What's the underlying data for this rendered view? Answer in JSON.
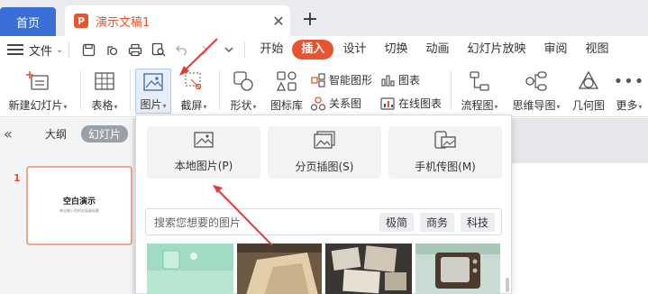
{
  "tabs": {
    "home": "首页",
    "doc_logo": "P",
    "doc_title": "演示文稿1",
    "close": "✕",
    "new": "+"
  },
  "menu": {
    "file": "文件",
    "tabs": [
      "开始",
      "插入",
      "设计",
      "切换",
      "动画",
      "幻灯片放映",
      "审阅",
      "视图"
    ],
    "active_tab": "插入"
  },
  "toolbar": {
    "new_slide": "新建幻灯片",
    "table": "表格",
    "picture": "图片",
    "screenshot": "截屏",
    "shape": "形状",
    "icon_lib": "图标库",
    "smart_art": "智能图形",
    "relation": "关系图",
    "chart": "图表",
    "online_chart": "在线图表",
    "flowchart": "流程图",
    "mindmap": "思维导图",
    "geometry": "几何图",
    "more": "更多"
  },
  "left_panel": {
    "collapse": "«",
    "outline": "大纲",
    "slides": "幻灯片",
    "slide_number": "1",
    "slide_title": "空白演示",
    "slide_subtitle": "单击输入您的封面副标题"
  },
  "picture_menu": {
    "local": "本地图片(P)",
    "paged": "分页插图(S)",
    "phone": "手机传图(M)",
    "search_placeholder": "搜索您想要的图片",
    "chips": [
      "极简",
      "商务",
      "科技"
    ]
  },
  "colors": {
    "accent": "#e8542f",
    "home_tab": "#3a6fd8",
    "arrow": "#e03a3a"
  }
}
